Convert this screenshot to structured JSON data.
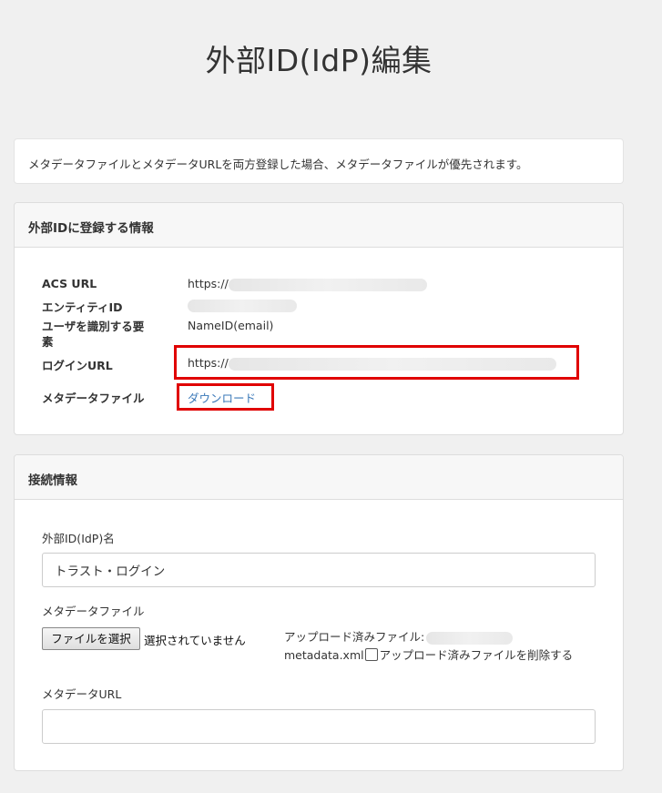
{
  "page": {
    "title": "外部ID(IdP)編集",
    "notice": "メタデータファイルとメタデータURLを両方登録した場合、メタデータファイルが優先されます。"
  },
  "info_panel": {
    "heading": "外部IDに登録する情報",
    "acs_url_label": "ACS URL",
    "acs_url_value": "https://",
    "entity_id_label": "エンティティID",
    "user_id_label_line1": "ユーザを識別する要",
    "user_id_label_line2": "素",
    "user_id_value": "NameID(email)",
    "login_url_label": "ログインURL",
    "login_url_value": "https://",
    "metadata_file_label": "メタデータファイル",
    "download_link": "ダウンロード"
  },
  "conn_panel": {
    "heading": "接続情報",
    "idp_name_label": "外部ID(IdP)名",
    "idp_name_value": "トラスト・ログイン",
    "metadata_file_label": "メタデータファイル",
    "choose_file_button": "ファイルを選択",
    "no_file_selected": "選択されていません",
    "uploaded_file_label": "アップロード済みファイル:",
    "uploaded_file_name": "metadata.xml",
    "delete_uploaded_label": "アップロード済みファイルを削除する",
    "metadata_url_label": "メタデータURL",
    "metadata_url_value": ""
  },
  "colors": {
    "highlight": "#e00000",
    "link": "#3a78b8",
    "background": "#f0f0f0"
  }
}
